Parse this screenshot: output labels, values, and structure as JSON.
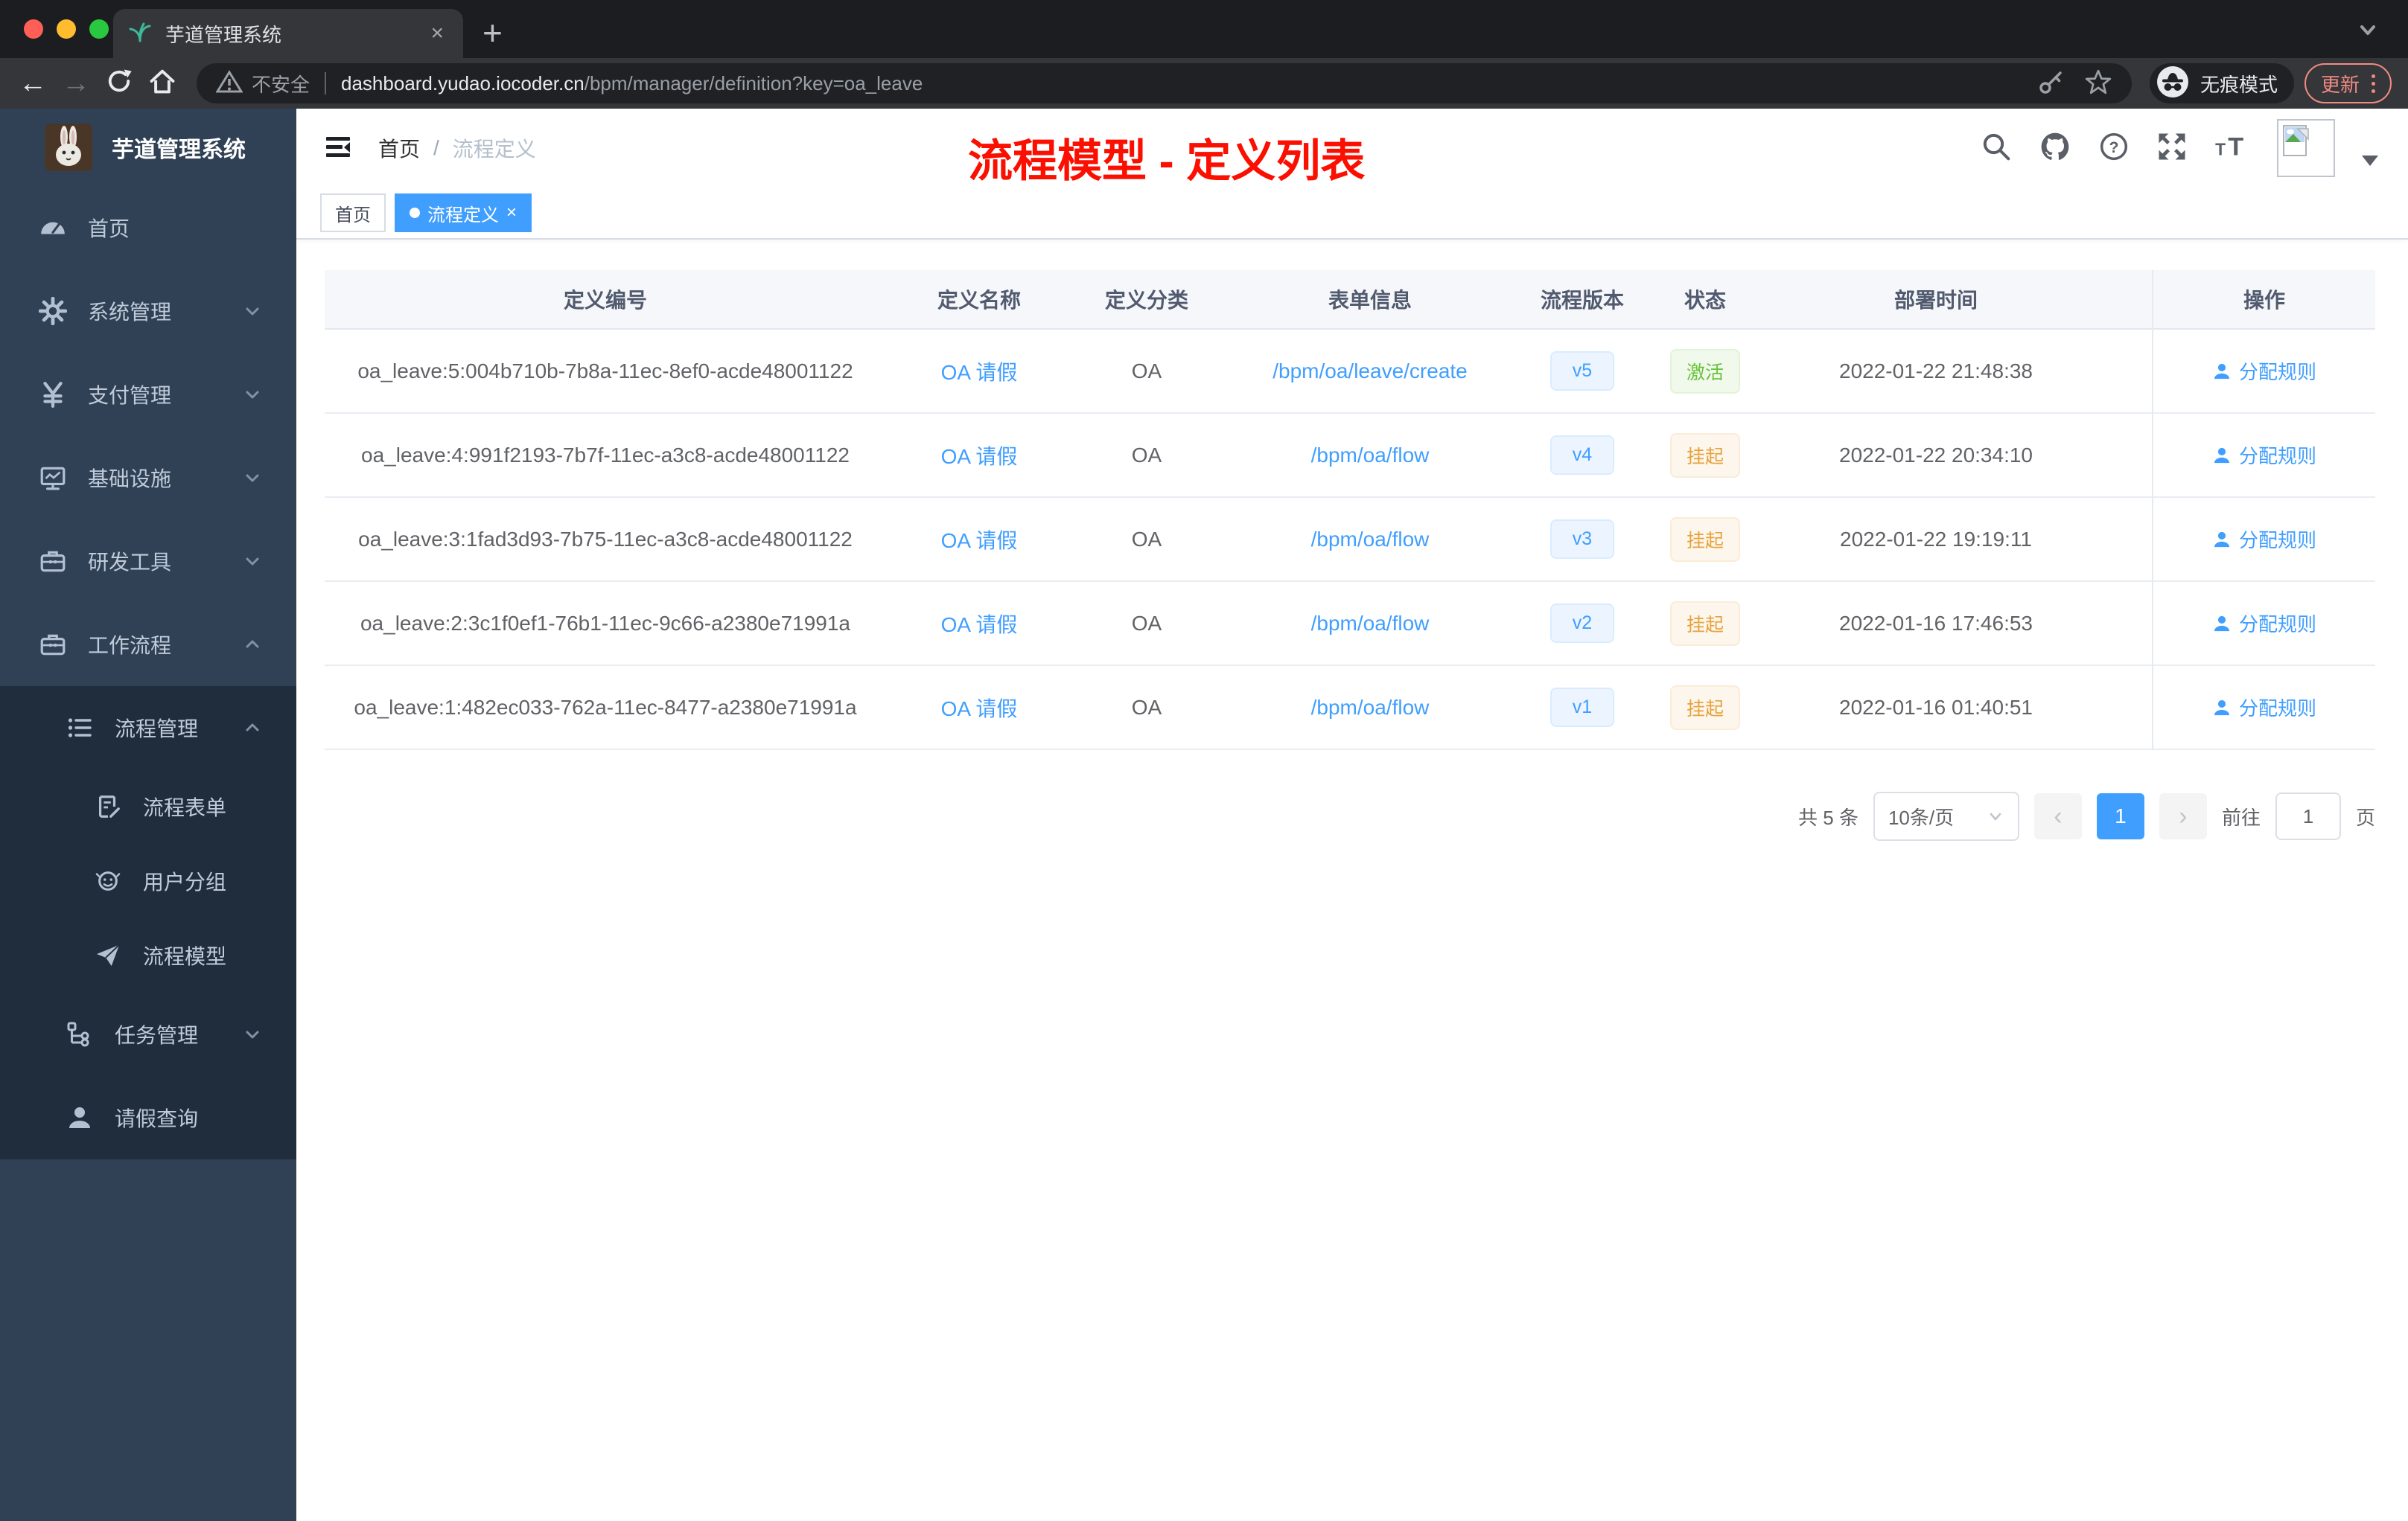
{
  "colors": {
    "accent": "#409eff",
    "sidebar_bg": "#304156",
    "submenu_bg": "#1f2d3d",
    "success": "#67c23a",
    "warning": "#e6a23c",
    "annotation_red": "#fb0f00"
  },
  "browser": {
    "tab_title": "芋道管理系统",
    "tab_close": "×",
    "new_tab_label": "+",
    "back_icon": "←",
    "forward_icon": "→",
    "security_label": "不安全",
    "url_domain": "dashboard.yudao.iocoder.cn",
    "url_path": "/bpm/manager/definition?key=oa_leave",
    "incognito_label": "无痕模式",
    "update_label": "更新"
  },
  "sidebar": {
    "title": "芋道管理系统",
    "items": [
      {
        "label": "首页",
        "icon": "dashboard-icon"
      },
      {
        "label": "系统管理",
        "icon": "gear-icon"
      },
      {
        "label": "支付管理",
        "icon": "yen-icon"
      },
      {
        "label": "基础设施",
        "icon": "monitor-icon"
      },
      {
        "label": "研发工具",
        "icon": "toolbox-icon"
      },
      {
        "label": "工作流程",
        "icon": "workflow-icon"
      },
      {
        "label": "流程管理",
        "icon": "process-list-icon"
      },
      {
        "label": "流程表单",
        "icon": "form-icon"
      },
      {
        "label": "用户分组",
        "icon": "user-group-icon"
      },
      {
        "label": "流程模型",
        "icon": "paper-plane-icon"
      },
      {
        "label": "任务管理",
        "icon": "task-tree-icon"
      },
      {
        "label": "请假查询",
        "icon": "person-icon"
      }
    ]
  },
  "navbar": {
    "breadcrumb_home": "首页",
    "breadcrumb_separator": "/",
    "breadcrumb_current": "流程定义"
  },
  "annotation": {
    "text": "流程模型 - 定义列表"
  },
  "tags": {
    "home": "首页",
    "active": "流程定义",
    "close": "×"
  },
  "table": {
    "headers": [
      "定义编号",
      "定义名称",
      "定义分类",
      "表单信息",
      "流程版本",
      "状态",
      "部署时间",
      "操作"
    ],
    "action_label": "分配规则",
    "rows": [
      {
        "id": "oa_leave:5:004b710b-7b8a-11ec-8ef0-acde48001122",
        "name": "OA 请假",
        "category": "OA",
        "form": "/bpm/oa/leave/create",
        "version": "v5",
        "status": "激活",
        "deployed_at": "2022-01-22 21:48:38"
      },
      {
        "id": "oa_leave:4:991f2193-7b7f-11ec-a3c8-acde48001122",
        "name": "OA 请假",
        "category": "OA",
        "form": "/bpm/oa/flow",
        "version": "v4",
        "status": "挂起",
        "deployed_at": "2022-01-22 20:34:10"
      },
      {
        "id": "oa_leave:3:1fad3d93-7b75-11ec-a3c8-acde48001122",
        "name": "OA 请假",
        "category": "OA",
        "form": "/bpm/oa/flow",
        "version": "v3",
        "status": "挂起",
        "deployed_at": "2022-01-22 19:19:11"
      },
      {
        "id": "oa_leave:2:3c1f0ef1-76b1-11ec-9c66-a2380e71991a",
        "name": "OA 请假",
        "category": "OA",
        "form": "/bpm/oa/flow",
        "version": "v2",
        "status": "挂起",
        "deployed_at": "2022-01-16 17:46:53"
      },
      {
        "id": "oa_leave:1:482ec033-762a-11ec-8477-a2380e71991a",
        "name": "OA 请假",
        "category": "OA",
        "form": "/bpm/oa/flow",
        "version": "v1",
        "status": "挂起",
        "deployed_at": "2022-01-16 01:40:51"
      }
    ]
  },
  "pagination": {
    "total": "共 5 条",
    "page_size": "10条/页",
    "prev": "‹",
    "page": "1",
    "next": "›",
    "goto_label": "前往",
    "goto_value": "1",
    "unit": "页"
  }
}
